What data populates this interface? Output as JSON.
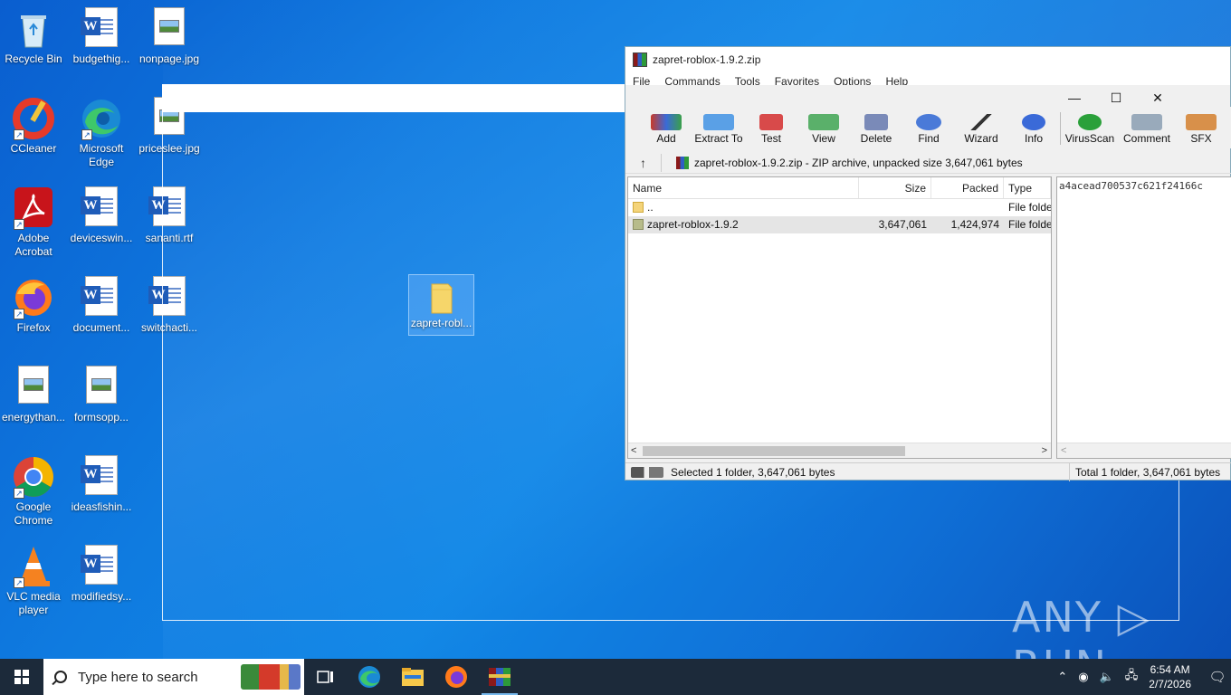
{
  "desktop": {
    "icons": [
      {
        "label": "Recycle Bin"
      },
      {
        "label": "budgethig..."
      },
      {
        "label": "nonpage.jpg"
      },
      {
        "label": "CCleaner"
      },
      {
        "label": "Microsoft Edge"
      },
      {
        "label": "priceslee.jpg"
      },
      {
        "label": "Adobe Acrobat"
      },
      {
        "label": "deviceswin..."
      },
      {
        "label": "sananti.rtf"
      },
      {
        "label": "Firefox"
      },
      {
        "label": "document..."
      },
      {
        "label": "switchacti..."
      },
      {
        "label": "energythan..."
      },
      {
        "label": "formsopp..."
      },
      {
        "label": "Google Chrome"
      },
      {
        "label": "ideasfishin..."
      },
      {
        "label": "VLC media player"
      },
      {
        "label": "modifiedsy..."
      },
      {
        "label": "zapret-robl..."
      }
    ]
  },
  "winrar": {
    "title": "zapret-roblox-1.9.2.zip",
    "menu": [
      "File",
      "Commands",
      "Tools",
      "Favorites",
      "Options",
      "Help"
    ],
    "toolbar": [
      "Add",
      "Extract To",
      "Test",
      "View",
      "Delete",
      "Find",
      "Wizard",
      "Info",
      "VirusScan",
      "Comment",
      "SFX"
    ],
    "address": "zapret-roblox-1.9.2.zip - ZIP archive, unpacked size 3,647,061 bytes",
    "up_arrow": "↑",
    "columns": {
      "name": "Name",
      "size": "Size",
      "packed": "Packed",
      "type": "Type"
    },
    "rows": [
      {
        "name": "..",
        "size": "",
        "packed": "",
        "type": "File folder"
      },
      {
        "name": "zapret-roblox-1.9.2",
        "size": "3,647,061",
        "packed": "1,424,974",
        "type": "File folder"
      }
    ],
    "info_hash": "a4acead700537c621f24166c",
    "status_left": "Selected 1 folder, 3,647,061 bytes",
    "status_right": "Total 1 folder, 3,647,061 bytes"
  },
  "window_controls": {
    "minimize": "—",
    "maximize": "☐",
    "close": "✕"
  },
  "taskbar": {
    "search_placeholder": "Type here to search",
    "time": "6:54 AM",
    "date": "2/7/2026"
  },
  "watermark": "ANY ▷ RUN"
}
